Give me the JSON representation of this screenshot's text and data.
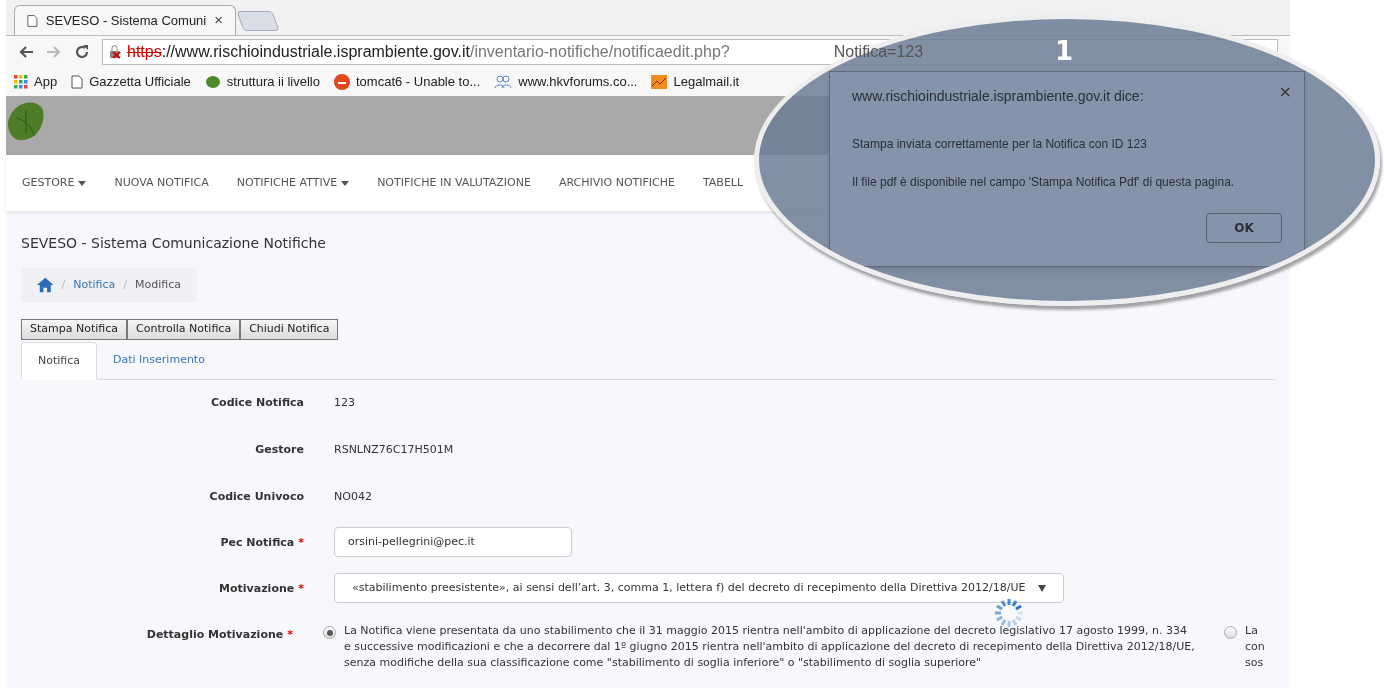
{
  "browser": {
    "tab_title": "SEVESO - Sistema Comuni",
    "tab_close": "×",
    "url_host": "https://www.rischioindustriale.isprambiente.gov.it",
    "url_path": "/inventario-notifiche/notificaedit.php?",
    "url_rest": "Notifica=123",
    "bookmarks": [
      {
        "label": "App",
        "kind": "apps"
      },
      {
        "label": "Gazzetta Ufficiale",
        "kind": "page"
      },
      {
        "label": "struttura ii livello",
        "kind": "leaf"
      },
      {
        "label": "tomcat6 - Unable to...",
        "kind": "ask"
      },
      {
        "label": "www.hkvforums.co...",
        "kind": "people"
      },
      {
        "label": "Legalmail.it",
        "kind": "chart"
      }
    ]
  },
  "nav": [
    {
      "label": "GESTORE",
      "dropdown": true
    },
    {
      "label": "NUOVA NOTIFICA",
      "dropdown": false
    },
    {
      "label": "NOTIFICHE ATTIVE",
      "dropdown": true
    },
    {
      "label": "NOTIFICHE IN VALUTAZIONE",
      "dropdown": false
    },
    {
      "label": "ARCHIVIO NOTIFICHE",
      "dropdown": false
    },
    {
      "label": "TABELL",
      "dropdown": false
    }
  ],
  "page_title": "SEVESO - Sistema Comunicazione Notifiche",
  "breadcrumb": [
    {
      "separator": "/",
      "label": "Notifica",
      "link": true
    },
    {
      "separator": "/",
      "label": "Modifica",
      "link": false
    }
  ],
  "actions": [
    "Stampa Notifica",
    "Controlla Notifica",
    "Chiudi Notifica"
  ],
  "tabs": [
    {
      "label": "Notifica",
      "selected": true
    },
    {
      "label": "Dati Inserimento",
      "selected": false
    }
  ],
  "fields": [
    {
      "label": "Codice Notifica",
      "kind": "text",
      "value": "123"
    },
    {
      "label": "Gestore",
      "kind": "text",
      "value": "RSNLNZ76C17H501M"
    },
    {
      "label": "Codice Univoco",
      "kind": "text",
      "value": "NO042"
    },
    {
      "label": "Pec Notifica",
      "required_mark": "*",
      "kind": "input",
      "value": "orsini-pellegrini@pec.it"
    },
    {
      "label": "Motivazione",
      "required_mark": "*",
      "kind": "select",
      "value": "«stabilimento preesistente», ai sensi dell’art. 3, comma 1, lettera f) del decreto di recepimento della Direttiva 2012/18/UE"
    },
    {
      "label": "Dettaglio Motivazione",
      "required_mark": "*",
      "kind": "radio",
      "options": [
        {
          "text": "La Notifica viene presentata da uno stabilimento che il 31 maggio 2015 rientra nell'ambito di applicazione del decreto legislativo 17 agosto 1999, n. 334\ne successive modificazioni e che a decorrere dal 1º giugno 2015 rientra nell'ambito di applicazione del decreto di recepimento della Direttiva 2012/18/UE,\nsenza modifiche della sua classificazione come \"stabilimento di soglia inferiore\" o \"stabilimento di soglia superiore\"",
          "selected": true
        },
        {
          "text": "La\ncon\nsos",
          "selected": false
        }
      ]
    }
  ],
  "callout": {
    "number": "1",
    "dialog": {
      "title": "www.rischioindustriale.isprambiente.gov.it dice:",
      "messages": [
        "Stampa inviata correttamente per la Notifica con ID 123",
        "Il file pdf è disponibile nel campo 'Stampa Notifica Pdf' di questa pagina."
      ],
      "close": "×",
      "button": "OK"
    }
  }
}
